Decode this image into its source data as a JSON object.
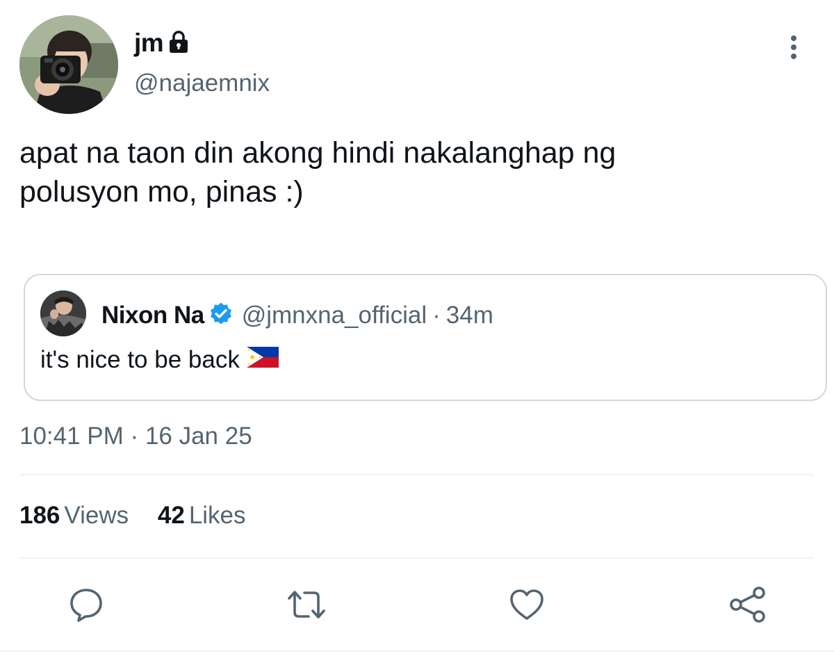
{
  "author": {
    "display_name": "jm",
    "handle": "@najaemnix",
    "protected": true,
    "avatar_icon": "user-avatar-photo"
  },
  "tweet": {
    "text": "apat na taon din akong hindi nakalanghap ng\npolusyon mo, pinas :)",
    "time": "10:41 PM",
    "separator": "·",
    "date": "16 Jan 25"
  },
  "quoted_tweet": {
    "display_name": "Nixon Na",
    "verified": true,
    "handle": "@jmnxna_official",
    "separator": "·",
    "time": "34m",
    "text": "it's nice to be back",
    "flag_icon": "philippines-flag-icon"
  },
  "stats": {
    "views_count": "186",
    "views_label": "Views",
    "likes_count": "42",
    "likes_label": "Likes"
  },
  "actions": {
    "reply_icon": "reply-icon",
    "retweet_icon": "retweet-icon",
    "like_icon": "heart-icon",
    "share_icon": "share-icon"
  },
  "colors": {
    "text_primary": "#0f1419",
    "text_secondary": "#536471",
    "border": "#cfd9de",
    "divider": "#eff3f4",
    "verified_blue": "#1d9bf0",
    "icon_gray": "#536471"
  }
}
